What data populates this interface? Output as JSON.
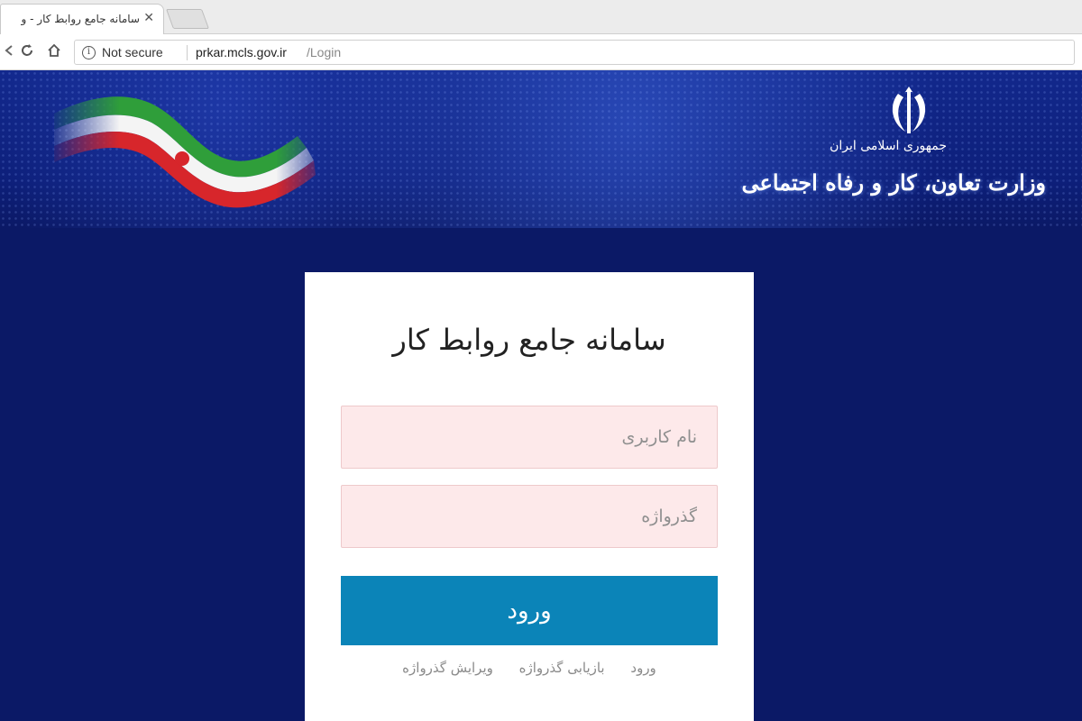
{
  "browser": {
    "tab_title": "سامانه جامع روابط کار - و",
    "tab_close": "✕",
    "security_label": "Not secure",
    "url_host": "prkar.mcls.gov.ir",
    "url_path": "/Login"
  },
  "header": {
    "ministry_small": "جمهوری اسلامی ایران",
    "ministry_name": "وزارت تعاون، کار و رفاه اجتماعی"
  },
  "login": {
    "title": "سامانه جامع روابط کار",
    "username_placeholder": "نام کاربری",
    "password_placeholder": "گذرواژه",
    "submit_label": "ورود",
    "links": [
      "ورود",
      "بازیابی گذرواژه",
      "ویرایش گذرواژه"
    ]
  },
  "colors": {
    "background": "#0b1966",
    "button": "#0b84b8",
    "field": "#fde9ea"
  }
}
